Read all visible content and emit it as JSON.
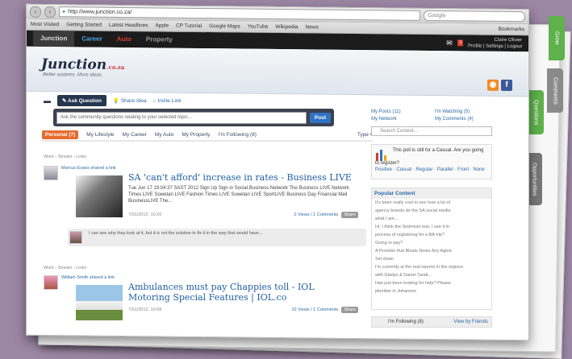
{
  "browser": {
    "address": "http://www.junction.co.za/",
    "search_placeholder": "Google",
    "bookmarks": [
      "Most Visited",
      "Getting Started",
      "Latest Headlines",
      "Apple",
      "CP Tutorial",
      "Google Maps",
      "YouTube",
      "Wikipedia",
      "News"
    ],
    "bookmarks_right": "Bookmarks"
  },
  "site": {
    "tabs": [
      "Junction",
      "Career",
      "Auto",
      "Property"
    ],
    "user_name": "Claire Olivier",
    "user_links": "Profile | Settings | Logout",
    "logo": "Junction",
    "logo_suffix": ".co.za",
    "tagline": "Better systems. More ideas."
  },
  "actions": {
    "ask": "Ask Question",
    "share": "Share Idea",
    "invite": "Invite Link"
  },
  "question": {
    "placeholder": "Ask the community questions relating to your selected topic...",
    "post": "Post"
  },
  "filters": {
    "active": "Personal (7)",
    "items": [
      "My Lifestyle",
      "My Career",
      "My Auto",
      "My Property",
      "I'm Following (8)"
    ],
    "type": "Type"
  },
  "right": {
    "links": [
      "My Posts (11)",
      "I'm Watching (5)",
      "My Network",
      "My Comments (4)"
    ],
    "search_placeholder": "Search Content...",
    "poll_text": "This poll is still for a Casual. Are you going to register?",
    "poll_options": "Positive · Casual · Regular · Parallel · Front · None",
    "popular_title": "Popular Content",
    "popular_items": [
      "It's been really cool to see how a lot of",
      "agency brands do the SA social media",
      "what I am...",
      "Hi, I think the Selenium test, I see it in",
      "process of registering for a BA trip?",
      "Going to pay?",
      "A Provider that Bloats Noise Any Agent",
      "Set down",
      "I'm currently at the real reports in the regions",
      "with Gladys & Daniel Tandi...",
      "Has just been looking for help? Please",
      "plumber in Johannes"
    ],
    "following": "I'm Following (8)",
    "follow_link": "View by Friends"
  },
  "feed": [
    {
      "meta": "Work › Stream › Links",
      "poster": "Marcus Evans shared a link",
      "title": "SA 'can't afford' increase in rates - Business LIVE",
      "desc": "Tue Jun 17 19:04:37 SAST 2012 Sign Up Sign in Social Business Network The Business LIVE Network Times LIVE Sowetan LIVE Fashion Times LIVE Sowetan LIVE SportLIVE Business Day Financial Mail BusinessLIVE The...",
      "date": "7/01/2012, 10:20",
      "links": "0 Views / 1 Comments",
      "share": "Share",
      "comment": "I can see why they look at it, but it is not the solution to fix it in the way that would have..."
    },
    {
      "meta": "Work › Stream › Links",
      "poster": "William Smith shared a link",
      "title": "Ambulances must pay Chappies toll - IOL Motoring Special Features | IOL.co",
      "date": "7/01/2012, 10:08",
      "links": "10 Views / 1 Comments",
      "share": "Share"
    }
  ],
  "side_tabs": [
    "Grow",
    "Comments",
    "Questions",
    "Opportunities"
  ],
  "colors": {
    "accent": "#e76a2f",
    "link": "#1f5fa3",
    "topbar": "#1b1b1b"
  }
}
